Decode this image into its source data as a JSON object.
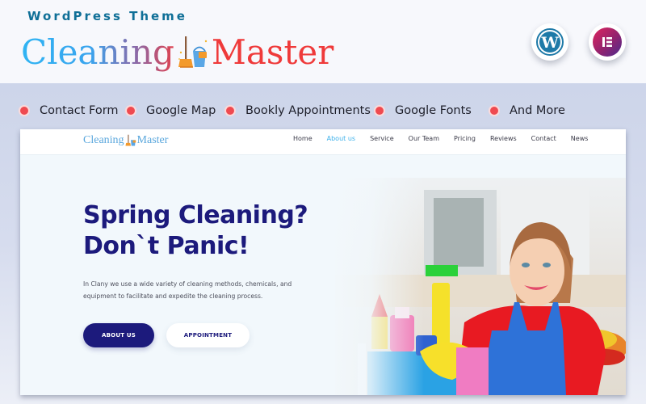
{
  "banner": {
    "subtitle": "WordPress Theme",
    "title_part1": "Cleaning",
    "title_part2": "Master",
    "badges": [
      {
        "name": "wordpress-icon",
        "label": "WordPress"
      },
      {
        "name": "elementor-icon",
        "label": "Elementor"
      }
    ]
  },
  "features": [
    {
      "label": "Contact Form"
    },
    {
      "label": "Google Map"
    },
    {
      "label": "Bookly Appointments"
    },
    {
      "label": "Google Fonts"
    },
    {
      "label": "And More"
    }
  ],
  "site": {
    "logo_part1": "Cleaning",
    "logo_part2": "Master",
    "nav": [
      {
        "label": "Home",
        "active": false
      },
      {
        "label": "About us",
        "active": true
      },
      {
        "label": "Service",
        "active": false
      },
      {
        "label": "Our Team",
        "active": false
      },
      {
        "label": "Pricing",
        "active": false
      },
      {
        "label": "Reviews",
        "active": false
      },
      {
        "label": "Contact",
        "active": false
      },
      {
        "label": "News",
        "active": false
      }
    ],
    "hero": {
      "title_line1": "Spring Cleaning?",
      "title_line2": "Don`t Panic!",
      "description_line1": "In Clany we use a wide variety of cleaning methods, chemicals, and",
      "description_line2": "equipment to facilitate and expedite the cleaning process.",
      "primary_button": "ABOUT US",
      "secondary_button": "APPOINTMENT",
      "image_alt": "Smiling woman in blue apron holding a bucket of cleaning supplies"
    }
  },
  "colors": {
    "accent_navy": "#1c1a7c",
    "accent_red": "#ef3a3a",
    "accent_blue": "#3db1ea",
    "bullet": "#ef4a50"
  }
}
